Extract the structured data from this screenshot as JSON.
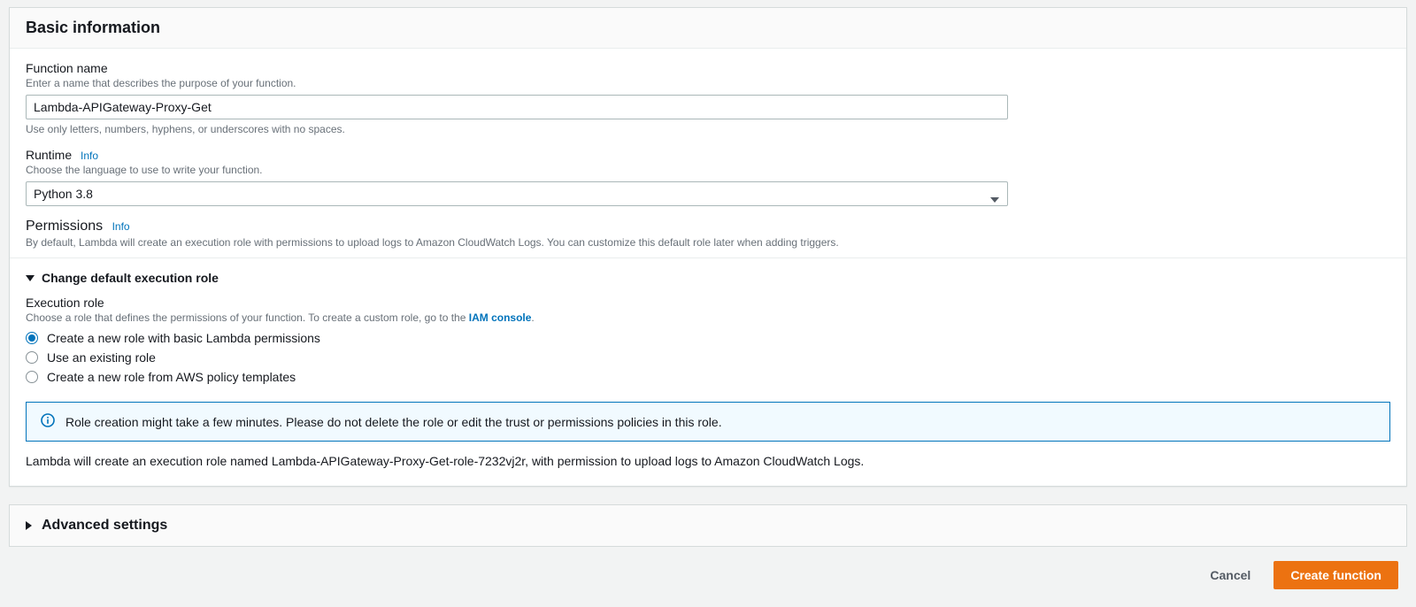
{
  "basic": {
    "header": "Basic information",
    "functionName": {
      "label": "Function name",
      "description": "Enter a name that describes the purpose of your function.",
      "value": "Lambda-APIGateway-Proxy-Get",
      "hint": "Use only letters, numbers, hyphens, or underscores with no spaces."
    },
    "runtime": {
      "label": "Runtime",
      "infoLabel": "Info",
      "description": "Choose the language to use to write your function.",
      "value": "Python 3.8"
    },
    "permissions": {
      "label": "Permissions",
      "infoLabel": "Info",
      "description": "By default, Lambda will create an execution role with permissions to upload logs to Amazon CloudWatch Logs. You can customize this default role later when adding triggers."
    },
    "changeRole": {
      "toggleLabel": "Change default execution role",
      "executionRoleLabel": "Execution role",
      "descPrefix": "Choose a role that defines the permissions of your function. To create a custom role, go to the ",
      "iamLinkText": "IAM console",
      "descSuffix": ".",
      "options": [
        "Create a new role with basic Lambda permissions",
        "Use an existing role",
        "Create a new role from AWS policy templates"
      ],
      "selectedIndex": 0,
      "alertText": "Role creation might take a few minutes. Please do not delete the role or edit the trust or permissions policies in this role.",
      "roleNote": "Lambda will create an execution role named Lambda-APIGateway-Proxy-Get-role-7232vj2r, with permission to upload logs to Amazon CloudWatch Logs."
    }
  },
  "advanced": {
    "header": "Advanced settings"
  },
  "footer": {
    "cancel": "Cancel",
    "create": "Create function"
  }
}
